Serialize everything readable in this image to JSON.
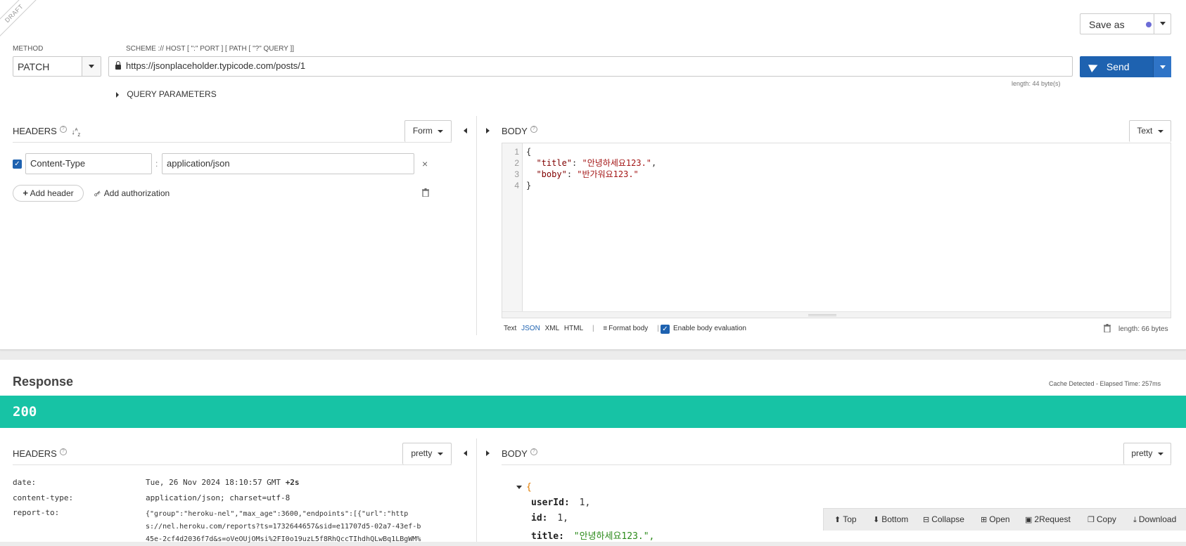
{
  "draft_label": "DRAFT",
  "save_as": {
    "label": "Save as",
    "dot_color": "#6c6cd6"
  },
  "method": {
    "caption": "METHOD",
    "value": "PATCH"
  },
  "url": {
    "caption": "SCHEME :// HOST [ \":\" PORT ] [ PATH [ \"?\" QUERY ]]",
    "value": "https://jsonplaceholder.typicode.com/posts/1",
    "length": "length: 44 byte(s)"
  },
  "send": {
    "label": "Send"
  },
  "query_parameters": {
    "label": "QUERY PARAMETERS"
  },
  "request_headers": {
    "title": "HEADERS",
    "mode": "Form",
    "items": [
      {
        "name": "Content-Type",
        "value": "application/json",
        "enabled": true
      }
    ],
    "add_header": "Add header",
    "add_authorization": "Add authorization"
  },
  "request_body": {
    "title": "BODY",
    "mode": "Text",
    "line_numbers": [
      "1",
      "2",
      "3",
      "4"
    ],
    "code": {
      "open": "{",
      "title_key": "\"title\"",
      "title_value": "\"안녕하세요123.\"",
      "boby_key": "\"boby\"",
      "boby_value": "\"반가워요123.\"",
      "close": "}"
    },
    "formats": [
      "Text",
      "JSON",
      "XML",
      "HTML"
    ],
    "active_format": "JSON",
    "format_body": "Format body",
    "enable_eval": "Enable body evaluation",
    "length": "length: 66 bytes"
  },
  "response": {
    "title": "Response",
    "elapsed": "Cache Detected - Elapsed Time: 257ms",
    "status": "200",
    "status_color": "#17c3a5",
    "headers": {
      "title": "HEADERS",
      "mode": "pretty",
      "rows": [
        {
          "name": "date:",
          "value": "Tue, 26 Nov 2024 18:10:57 GMT",
          "extra": "+2s"
        },
        {
          "name": "content-type:",
          "value": "application/json; charset=utf-8",
          "extra": ""
        },
        {
          "name": "report-to:",
          "value": "{\"group\":\"heroku-nel\",\"max_age\":3600,\"endpoints\":[{\"url\":\"http",
          "extra": ""
        }
      ],
      "report_to_cont": [
        "s://nel.heroku.com/reports?ts=1732644657&sid=e11707d5-02a7-43ef-b",
        "45e-2cf4d2036f7d&s=oVeOUjOMsi%2FI0o19uzL5f8RhQccTIhdhQLwBq1LBgWM%"
      ]
    },
    "body": {
      "title": "BODY",
      "mode": "pretty",
      "open": "{",
      "lines": [
        {
          "key": "userId:",
          "value": "1,",
          "type": "num"
        },
        {
          "key": "id:",
          "value": "1,",
          "type": "num"
        },
        {
          "key": "title:",
          "value": "\"안녕하세요123.\",",
          "type": "str"
        }
      ]
    },
    "toolbar": [
      "Top",
      "Bottom",
      "Collapse",
      "Open",
      "2Request",
      "Copy",
      "Download"
    ]
  }
}
